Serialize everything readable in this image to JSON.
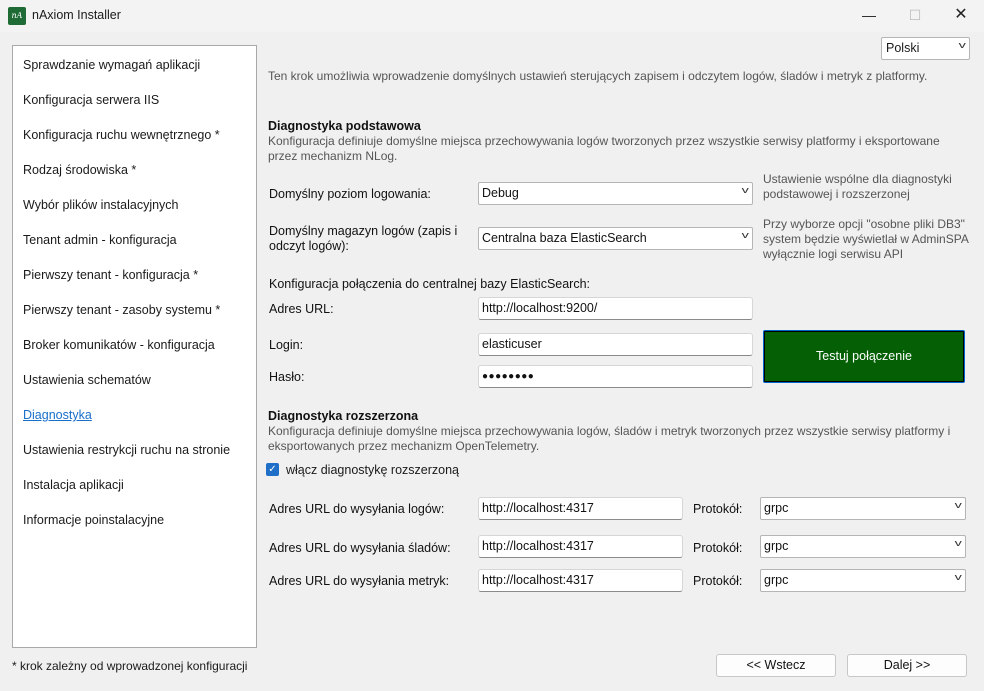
{
  "window": {
    "title": "nAxiom Installer",
    "app_icon_text": "nA",
    "minimize": "—",
    "maximize": "☐",
    "close": "✕"
  },
  "sidebar": {
    "items": [
      {
        "label": "Sprawdzanie wymagań aplikacji"
      },
      {
        "label": "Konfiguracja serwera IIS"
      },
      {
        "label": "Konfiguracja ruchu wewnętrznego *"
      },
      {
        "label": "Rodzaj środowiska *"
      },
      {
        "label": "Wybór plików instalacyjnych"
      },
      {
        "label": "Tenant admin - konfiguracja"
      },
      {
        "label": "Pierwszy tenant - konfiguracja *"
      },
      {
        "label": "Pierwszy tenant - zasoby systemu *"
      },
      {
        "label": "Broker komunikatów - konfiguracja"
      },
      {
        "label": "Ustawienia schematów"
      },
      {
        "label": "Diagnostyka",
        "active": true
      },
      {
        "label": "Ustawienia restrykcji ruchu na stronie"
      },
      {
        "label": "Instalacja aplikacji"
      },
      {
        "label": "Informacje poinstalacyjne"
      }
    ]
  },
  "footnote": "* krok zależny od wprowadzonej konfiguracji",
  "language": {
    "selected": "Polski",
    "chevron": "v"
  },
  "intro": "Ten krok umożliwia wprowadzenie domyślnych ustawień sterujących zapisem i odczytem logów, śladów i metryk z platformy.",
  "basic": {
    "title": "Diagnostyka podstawowa",
    "description": "Konfiguracja definiuje domyślne miejsca przechowywania logów tworzonych przez wszystkie serwisy platformy i eksportowane przez mechanizm NLog.",
    "log_level_label": "Domyślny poziom logowania:",
    "log_level_value": "Debug",
    "log_level_note": "Ustawienie wspólne dla diagnostyki podstawowej i rozszerzonej",
    "log_store_label": "Domyślny magazyn logów (zapis i odczyt logów):",
    "log_store_value": "Centralna baza ElasticSearch",
    "log_store_note": "Przy wyborze opcji \"osobne pliki DB3\" system będzie wyświetlał w AdminSPA wyłącznie logi serwisu API",
    "es_header": "Konfiguracja połączenia do centralnej bazy ElasticSearch:",
    "url_label": "Adres URL:",
    "url_value": "http://localhost:9200/",
    "login_label": "Login:",
    "login_value": "elasticuser",
    "password_label": "Hasło:",
    "password_value": "●●●●●●●●",
    "test_button": "Testuj połączenie"
  },
  "extended": {
    "title": "Diagnostyka rozszerzona",
    "description": "Konfiguracja definiuje domyślne miejsca przechowywania logów, śladów i metryk tworzonych przez wszystkie serwisy platformy i eksportowanych przez mechanizm OpenTelemetry.",
    "enable_label": "włącz diagnostykę rozszerzoną",
    "enabled": true,
    "check_glyph": "✓",
    "protocol_label": "Protokół:",
    "rows": [
      {
        "label": "Adres URL do wysyłania logów:",
        "url": "http://localhost:4317",
        "protocol": "grpc"
      },
      {
        "label": "Adres URL do wysyłania śladów:",
        "url": "http://localhost:4317",
        "protocol": "grpc"
      },
      {
        "label": "Adres URL do wysyłania metryk:",
        "url": "http://localhost:4317",
        "protocol": "grpc"
      }
    ]
  },
  "nav": {
    "back": "<< Wstecz",
    "next": "Dalej >>"
  }
}
